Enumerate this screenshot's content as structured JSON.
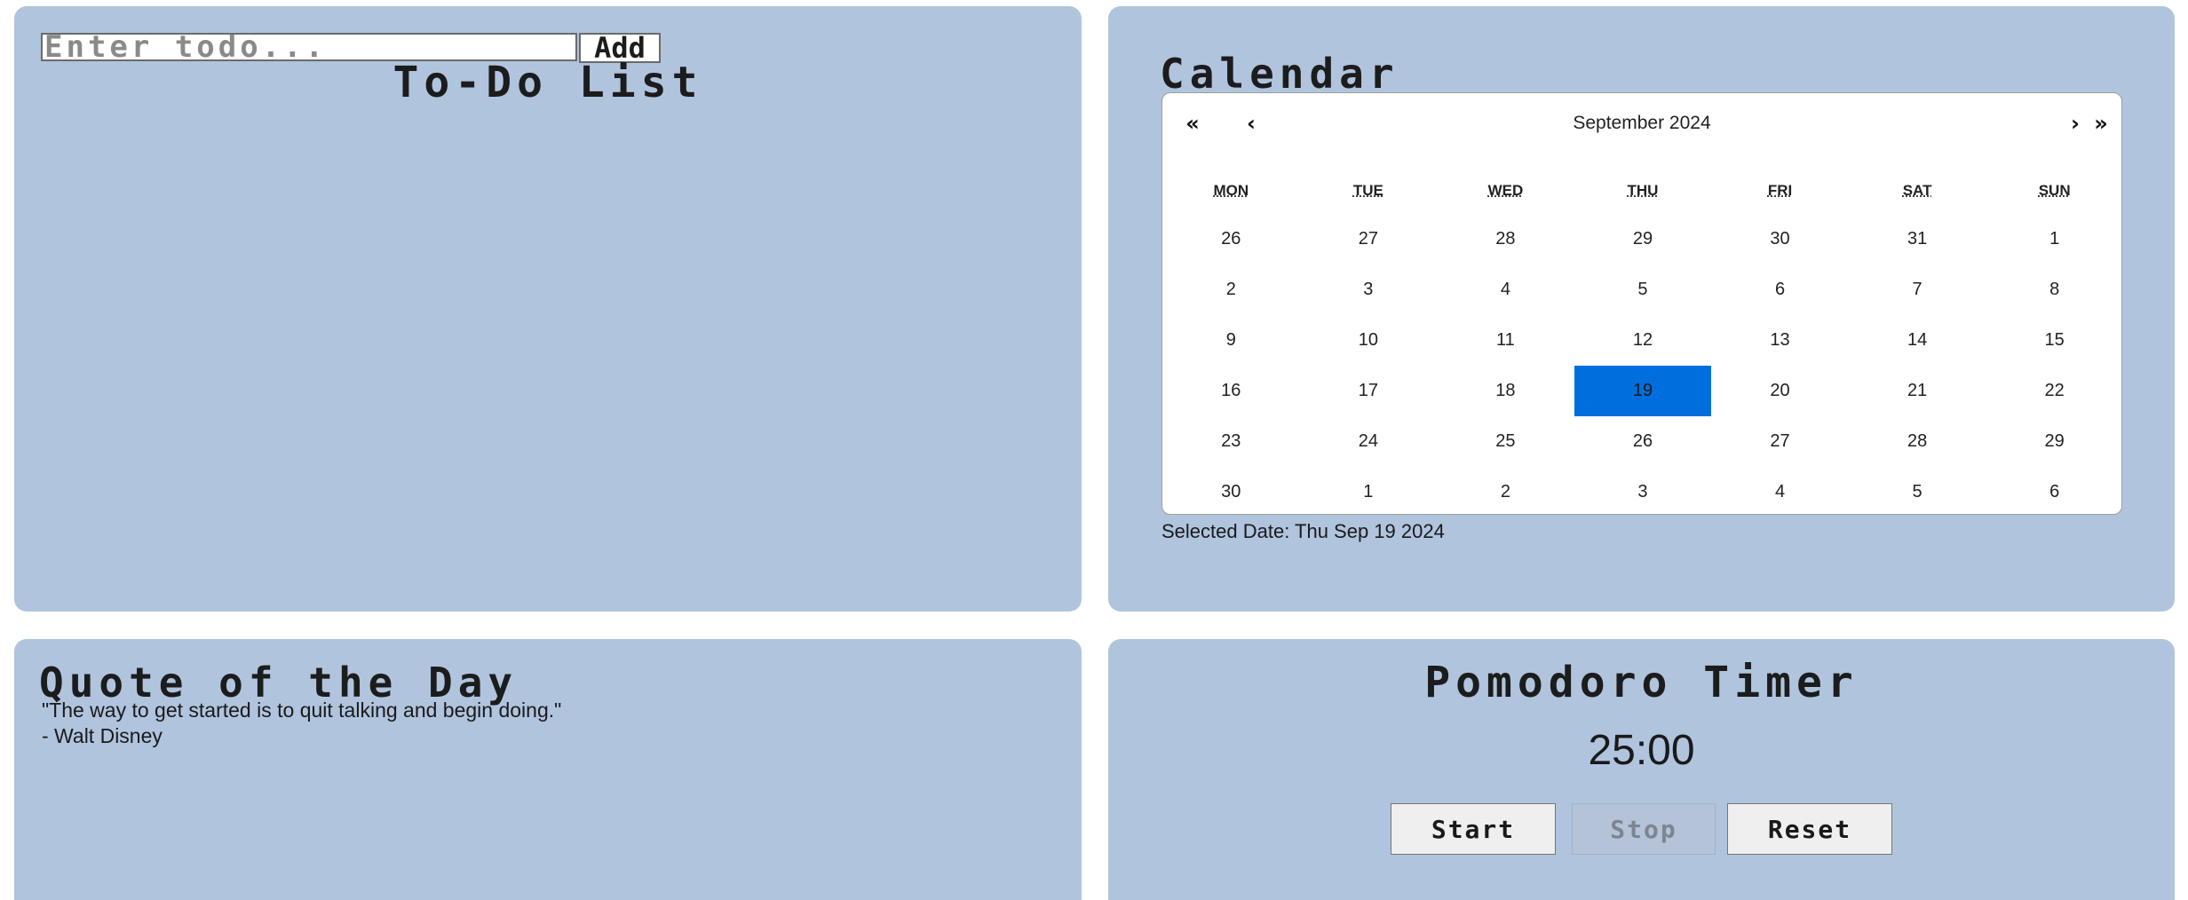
{
  "todo": {
    "input_placeholder": "Enter todo...",
    "input_value": "",
    "add_label": "Add",
    "title": "To-Do List",
    "items": []
  },
  "calendar": {
    "title": "Calendar",
    "month_label": "September 2024",
    "nav": {
      "prev_year": "«",
      "prev_month": "‹",
      "next_month": "›",
      "next_year": "»"
    },
    "weekdays": [
      "MON",
      "TUE",
      "WED",
      "THU",
      "FRI",
      "SAT",
      "SUN"
    ],
    "days": [
      "26",
      "27",
      "28",
      "29",
      "30",
      "31",
      "1",
      "2",
      "3",
      "4",
      "5",
      "6",
      "7",
      "8",
      "9",
      "10",
      "11",
      "12",
      "13",
      "14",
      "15",
      "16",
      "17",
      "18",
      "19",
      "20",
      "21",
      "22",
      "23",
      "24",
      "25",
      "26",
      "27",
      "28",
      "29",
      "30",
      "1",
      "2",
      "3",
      "4",
      "5",
      "6"
    ],
    "selected_index": 24,
    "selected_color": "#006edc",
    "selected_text": "Selected Date: Thu Sep 19 2024"
  },
  "quote": {
    "title": "Quote of the Day",
    "text": "\"The way to get started is to quit talking and begin doing.\"",
    "author": "- Walt Disney"
  },
  "pomodoro": {
    "title": "Pomodoro Timer",
    "time": "25:00",
    "start_label": "Start",
    "stop_label": "Stop",
    "reset_label": "Reset",
    "stop_disabled": true
  },
  "colors": {
    "panel_background": "#b0c4de",
    "page_background": "#ffffff"
  }
}
